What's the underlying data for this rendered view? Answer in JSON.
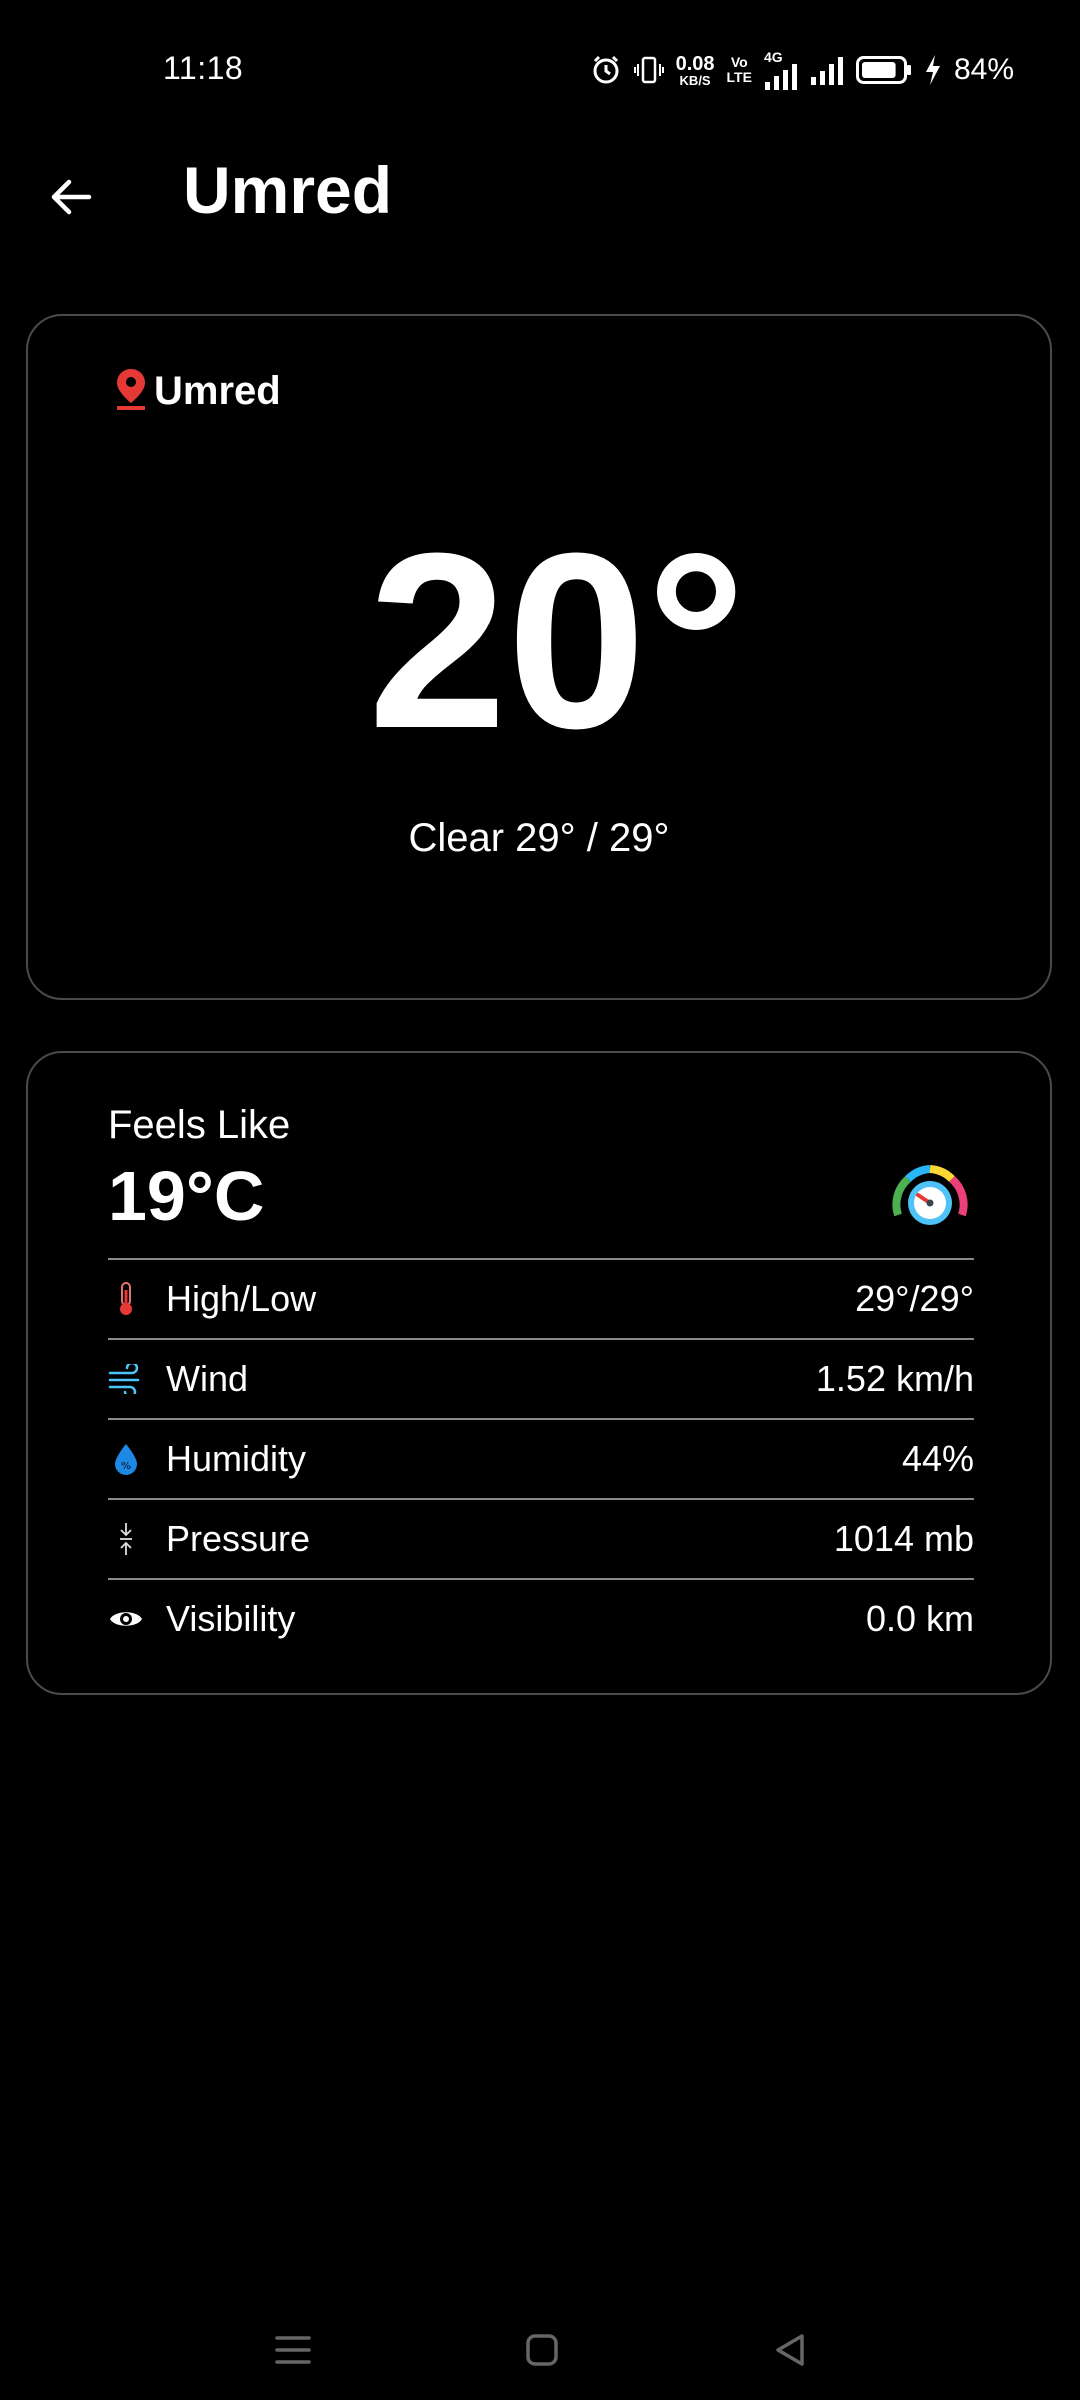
{
  "status_bar": {
    "time": "11:18",
    "net_speed_value": "0.08",
    "net_speed_unit": "KB/S",
    "volte_top": "Vo",
    "volte_bottom": "LTE",
    "network_type": "4G",
    "battery_percent": "84%",
    "battery_level": 0.84,
    "charging": true,
    "icons": [
      "alarm-icon",
      "vibrate-icon",
      "volte-icon",
      "signal-4g-icon",
      "signal-icon",
      "battery-icon",
      "charging-icon"
    ]
  },
  "app_bar": {
    "title": "Umred",
    "back_icon": "arrow-left-icon"
  },
  "current_weather": {
    "location_icon": "location-pin-icon",
    "location": "Umred",
    "temperature": "20°",
    "condition_line": "Clear 29° / 29°"
  },
  "details": {
    "feels_like_label": "Feels Like",
    "feels_like_value": "19°C",
    "gauge_icon": "gauge-icon",
    "rows": [
      {
        "icon": "thermometer-icon",
        "label": "High/Low",
        "value": "29°/29°"
      },
      {
        "icon": "wind-icon",
        "label": "Wind",
        "value": "1.52 km/h"
      },
      {
        "icon": "humidity-drop-icon",
        "label": "Humidity",
        "value": "44%"
      },
      {
        "icon": "pressure-icon",
        "label": "Pressure",
        "value": "1014 mb"
      },
      {
        "icon": "eye-icon",
        "label": "Visibility",
        "value": "0.0 km"
      }
    ]
  },
  "nav_bar": {
    "icons": [
      "menu-icon",
      "home-icon",
      "back-triangle-icon"
    ]
  },
  "colors": {
    "background": "#000000",
    "card_border": "#4a4a4a",
    "divider": "#8a8a8a",
    "pin": "#e53935",
    "thermometer": "#e53935",
    "wind": "#4fc3f7",
    "humidity": "#1e88e5"
  }
}
